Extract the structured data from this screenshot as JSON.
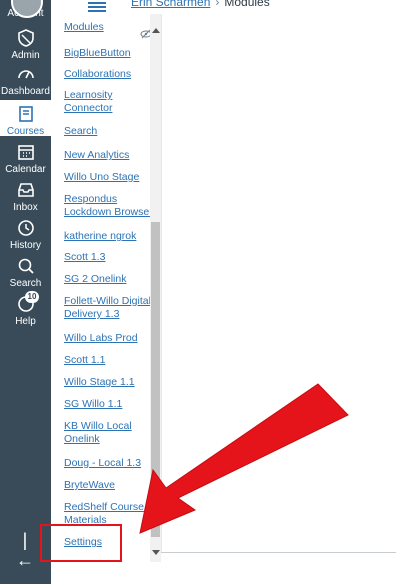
{
  "global_nav": {
    "items": [
      {
        "key": "account",
        "label": "Account",
        "icon": "account-avatar"
      },
      {
        "key": "admin",
        "label": "Admin",
        "icon": "shield-icon"
      },
      {
        "key": "dashboard",
        "label": "Dashboard",
        "icon": "speedometer-icon"
      },
      {
        "key": "courses",
        "label": "Courses",
        "icon": "book-icon",
        "active": true
      },
      {
        "key": "calendar",
        "label": "Calendar",
        "icon": "calendar-icon"
      },
      {
        "key": "inbox",
        "label": "Inbox",
        "icon": "inbox-icon"
      },
      {
        "key": "history",
        "label": "History",
        "icon": "clock-icon"
      },
      {
        "key": "search",
        "label": "Search",
        "icon": "magnifier-icon"
      },
      {
        "key": "help",
        "label": "Help",
        "icon": "help-icon",
        "badge": "10"
      }
    ],
    "collapse_glyph": "|←"
  },
  "breadcrumb": {
    "course": "Erin Scharmen",
    "separator": "›",
    "current": "Modules"
  },
  "course_nav": [
    {
      "label": "Modules",
      "lines": [
        "Modules"
      ],
      "hidden": true
    },
    {
      "label": "BigBlueButton",
      "lines": [
        "BigBlueButton"
      ]
    },
    {
      "label": "Collaborations",
      "lines": [
        "Collaborations"
      ]
    },
    {
      "label": "Learnosity Connector",
      "lines": [
        "Learnosity",
        "Connector"
      ]
    },
    {
      "label": "Search",
      "lines": [
        "Search"
      ]
    },
    {
      "label": "New Analytics",
      "lines": [
        "New Analytics"
      ]
    },
    {
      "label": "Willo Uno Stage",
      "lines": [
        "Willo Uno Stage"
      ]
    },
    {
      "label": "Respondus Lockdown Browser",
      "lines": [
        "Respondus",
        "Lockdown Browser"
      ]
    },
    {
      "label": "katherine ngrok",
      "lines": [
        "katherine ngrok"
      ]
    },
    {
      "label": "Scott 1.3",
      "lines": [
        "Scott 1.3"
      ]
    },
    {
      "label": "SG 2 Onelink",
      "lines": [
        "SG 2 Onelink"
      ]
    },
    {
      "label": "Follett-Willo Digital Delivery 1.3",
      "lines": [
        "Follett-Willo Digital",
        "Delivery 1.3"
      ]
    },
    {
      "label": "Willo Labs Prod",
      "lines": [
        "Willo Labs Prod"
      ]
    },
    {
      "label": "Scott 1.1",
      "lines": [
        "Scott 1.1"
      ]
    },
    {
      "label": "Willo Stage 1.1",
      "lines": [
        "Willo Stage 1.1"
      ]
    },
    {
      "label": "SG Willo 1.1",
      "lines": [
        "SG Willo 1.1"
      ]
    },
    {
      "label": "KB Willo Local Onelink",
      "lines": [
        "KB Willo Local",
        "Onelink"
      ]
    },
    {
      "label": "Doug - Local 1.3",
      "lines": [
        "Doug - Local 1.3"
      ]
    },
    {
      "label": "BryteWave",
      "lines": [
        "BryteWave"
      ]
    },
    {
      "label": "RedShelf Course Materials",
      "lines": [
        "RedShelf Course",
        "Materials"
      ]
    },
    {
      "label": "Settings",
      "lines": [
        "Settings"
      ]
    }
  ],
  "colors": {
    "nav_bg": "#394b58",
    "link": "#2d73b4",
    "annotation": "#e5141b"
  }
}
